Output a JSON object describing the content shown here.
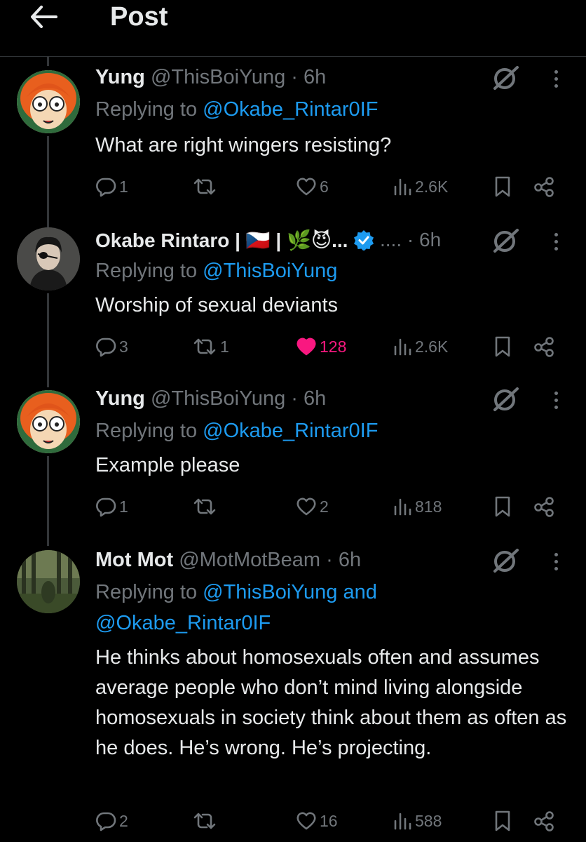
{
  "header": {
    "title": "Post"
  },
  "colors": {
    "accent": "#1d9bf0",
    "like": "#f91880",
    "muted": "#71767b",
    "text": "#e7e9ea"
  },
  "tweets": [
    {
      "name": "Yung",
      "handle": "@ThisBoiYung",
      "time": "· 6h",
      "reply_prefix": "Replying to ",
      "reply_handles": "@Okabe_Rintar0IF",
      "reply_handles_2": "",
      "text": "What are right wingers resisting?",
      "replies": "1",
      "reposts": "",
      "likes": "6",
      "views": "2.6K",
      "liked": false
    },
    {
      "name": "Okabe Rintaro | 🇨🇿 | 🌿😈...",
      "verified": true,
      "ellipsis": "....",
      "handle": "",
      "time": "· 6h",
      "reply_prefix": "Replying to ",
      "reply_handles": "@ThisBoiYung",
      "reply_handles_2": "",
      "text": "Worship of sexual deviants",
      "replies": "3",
      "reposts": "1",
      "likes": "128",
      "views": "2.6K",
      "liked": true
    },
    {
      "name": "Yung",
      "handle": "@ThisBoiYung",
      "time": "· 6h",
      "reply_prefix": "Replying to ",
      "reply_handles": "@Okabe_Rintar0IF",
      "reply_handles_2": "",
      "text": "Example please",
      "replies": "1",
      "reposts": "",
      "likes": "2",
      "views": "818",
      "liked": false
    },
    {
      "name": "Mot Mot",
      "handle": "@MotMotBeam",
      "time": "· 6h",
      "reply_prefix": "Replying to ",
      "reply_handles": "@ThisBoiYung and",
      "reply_handles_2": "@Okabe_Rintar0IF",
      "text": "He thinks about homosexuals often and assumes average people who don’t mind living alongside homosexuals in society think about them as often as he does. He’s wrong. He’s projecting.",
      "replies": "2",
      "reposts": "",
      "likes": "16",
      "views": "588",
      "liked": false
    }
  ]
}
